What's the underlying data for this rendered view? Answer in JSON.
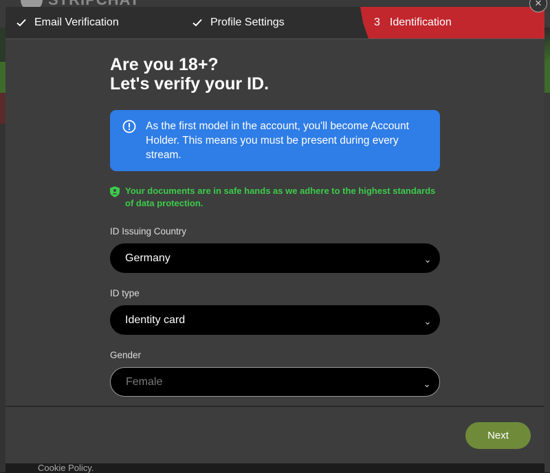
{
  "background": {
    "logo_text": "STRIPCHAT",
    "footer_link": "Cookie Policy."
  },
  "stepper": {
    "steps": [
      {
        "label": "Email Verification",
        "status": "done"
      },
      {
        "label": "Profile Settings",
        "status": "done"
      },
      {
        "number": "3",
        "label": "Identification",
        "status": "active"
      }
    ]
  },
  "main": {
    "title_line1": "Are you 18+?",
    "title_line2": "Let's verify your ID.",
    "info_text": "As the first model in the account, you'll become Account Holder. This means you must be present during every stream.",
    "safe_text": "Your documents are in safe hands as we adhere to the highest standards of data protection.",
    "fields": {
      "country": {
        "label": "ID Issuing Country",
        "value": "Germany"
      },
      "id_type": {
        "label": "ID type",
        "value": "Identity card"
      },
      "gender": {
        "label": "Gender",
        "value": "Female"
      }
    }
  },
  "footer": {
    "next_label": "Next"
  },
  "colors": {
    "accent_red": "#c2272d",
    "info_blue": "#2f7de6",
    "safe_green": "#3ccb4c",
    "next_green": "#6f8b3a"
  }
}
